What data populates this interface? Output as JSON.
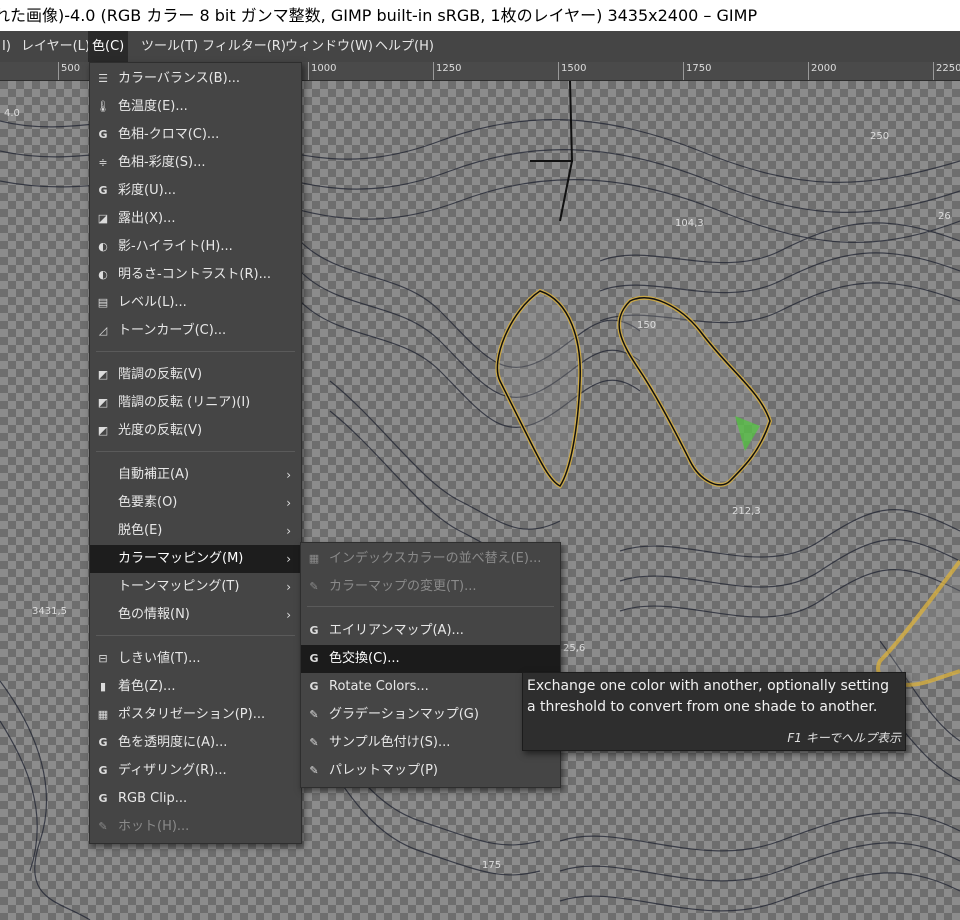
{
  "window": {
    "title": "れた画像)-4.0 (RGB カラー 8 bit ガンマ整数, GIMP built-in sRGB, 1枚のレイヤー) 3435x2400 – GIMP"
  },
  "menubar": {
    "items": [
      "I)",
      "レイヤー(L)",
      "色(C)",
      "ツール(T)",
      "フィルター(R)",
      "ウィンドウ(W)",
      "ヘルプ(H)"
    ]
  },
  "ruler": {
    "labels": [
      "500",
      "1000",
      "1250",
      "1500",
      "1750",
      "2000",
      "2250"
    ]
  },
  "canvas": {
    "labels": [
      "4.0",
      "104,3",
      "150",
      "212,3",
      "250",
      "26",
      "175",
      "25,6",
      "3431,5"
    ]
  },
  "color_menu": {
    "items": [
      {
        "label": "カラーバランス(B)...",
        "icon": "color-balance-icon"
      },
      {
        "label": "色温度(E)...",
        "icon": "thermometer-icon"
      },
      {
        "label": "色相-クロマ(C)...",
        "icon": "gegl-icon"
      },
      {
        "label": "色相-彩度(S)...",
        "icon": "hue-saturation-icon"
      },
      {
        "label": "彩度(U)...",
        "icon": "gegl-icon"
      },
      {
        "label": "露出(X)...",
        "icon": "exposure-icon"
      },
      {
        "label": "影-ハイライト(H)...",
        "icon": "shadows-highlights-icon"
      },
      {
        "label": "明るさ-コントラスト(R)...",
        "icon": "brightness-contrast-icon"
      },
      {
        "label": "レベル(L)...",
        "icon": "levels-icon"
      },
      {
        "label": "トーンカーブ(C)...",
        "icon": "curves-icon"
      },
      {
        "label": "階調の反転(V)",
        "icon": "invert-icon"
      },
      {
        "label": "階調の反転 (リニア)(I)",
        "icon": "invert-icon"
      },
      {
        "label": "光度の反転(V)",
        "icon": "invert-icon"
      },
      {
        "label": "自動補正(A)"
      },
      {
        "label": "色要素(O)"
      },
      {
        "label": "脱色(E)"
      },
      {
        "label": "カラーマッピング(M)"
      },
      {
        "label": "トーンマッピング(T)"
      },
      {
        "label": "色の情報(N)"
      },
      {
        "label": "しきい値(T)...",
        "icon": "threshold-icon"
      },
      {
        "label": "着色(Z)...",
        "icon": "colorize-icon"
      },
      {
        "label": "ポスタリゼーション(P)...",
        "icon": "posterize-icon"
      },
      {
        "label": "色を透明度に(A)...",
        "icon": "gegl-icon"
      },
      {
        "label": "ディザリング(R)...",
        "icon": "gegl-icon"
      },
      {
        "label": "RGB Clip...",
        "icon": "gegl-icon"
      },
      {
        "label": "ホット(H)...",
        "icon": "plugin-icon"
      }
    ]
  },
  "colormap_submenu": {
    "items": [
      {
        "label": "インデックスカラーの並べ替え(E)...",
        "icon": "indexed-icon"
      },
      {
        "label": "カラーマップの変更(T)...",
        "icon": "plugin-icon"
      },
      {
        "label": "エイリアンマップ(A)...",
        "icon": "gegl-icon"
      },
      {
        "label": "色交換(C)...",
        "icon": "gegl-icon"
      },
      {
        "label": "Rotate Colors...",
        "icon": "gegl-icon"
      },
      {
        "label": "グラデーションマップ(G)",
        "icon": "plugin-icon"
      },
      {
        "label": "サンプル色付け(S)...",
        "icon": "plugin-icon"
      },
      {
        "label": "パレットマップ(P)",
        "icon": "plugin-icon"
      }
    ]
  },
  "tooltip": {
    "line1": "Exchange one color with another, optionally setting",
    "line2": "a threshold to convert from one shade to another.",
    "hint": "F1 キーでヘルプ表示"
  }
}
